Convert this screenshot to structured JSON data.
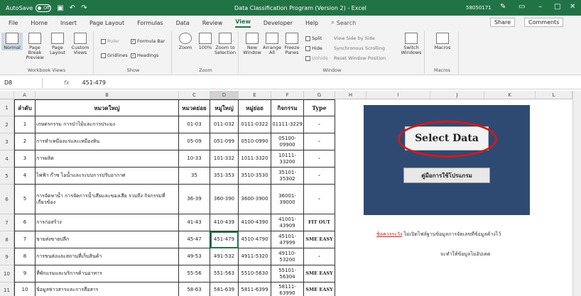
{
  "titlebar": {
    "autosave_label": "AutoSave",
    "autosave_state": "Off",
    "title": "Data Classification Program (Version 2) - Excel",
    "user": "58050171"
  },
  "menu": {
    "tabs": [
      "File",
      "Home",
      "Insert",
      "Page Layout",
      "Formulas",
      "Data",
      "Review",
      "View",
      "Developer",
      "Help"
    ],
    "active_tab": "View",
    "search_label": "Search",
    "share_label": "Share",
    "comments_label": "Comments"
  },
  "ribbon": {
    "workbook_views": {
      "label": "Workbook Views",
      "normal": "Normal",
      "page_break": "Page Break Preview",
      "page_layout": "Page Layout",
      "custom_views": "Custom Views"
    },
    "show": {
      "label": "Show",
      "ruler": "Ruler",
      "gridlines": "Gridlines",
      "formula_bar": "Formula Bar",
      "headings": "Headings"
    },
    "zoom": {
      "label": "Zoom",
      "zoom": "Zoom",
      "pct": "100%",
      "to_selection": "Zoom to Selection"
    },
    "window": {
      "label": "Window",
      "new_window": "New Window",
      "arrange_all": "Arrange All",
      "freeze_panes": "Freeze Panes",
      "split": "Split",
      "hide": "Hide",
      "unhide": "Unhide",
      "side_by_side": "View Side by Side",
      "sync_scroll": "Synchronous Scrolling",
      "reset_pos": "Reset Window Position",
      "switch_windows": "Switch Windows"
    },
    "macros": {
      "label": "Macros",
      "macros": "Macros"
    }
  },
  "formula_bar": {
    "name_box": "D8",
    "fx": "fx",
    "value": "451-479"
  },
  "sheet": {
    "columns": [
      "A",
      "B",
      "C",
      "D",
      "E",
      "F",
      "G",
      "H",
      "I",
      "J",
      "K",
      "L"
    ],
    "selected_column": "D",
    "row_numbers": [
      "1",
      "2",
      "3",
      "4",
      "5",
      "6",
      "7",
      "8",
      "9",
      "10",
      "11"
    ],
    "header": [
      "ลำดับ",
      "หมวดใหญ่",
      "หมวดย่อย",
      "หมู่ใหญ่",
      "หมู่ย่อย",
      "กิจกรรม",
      "Type"
    ],
    "rows": [
      [
        "1",
        "เกษตรกรรม การป่าไม้และการประมง",
        "01-03",
        "011-032",
        "0111-0322",
        "01111-3229",
        "-"
      ],
      [
        "2",
        "การทำเหมืองแร่และเหมืองหิน",
        "05-09",
        "051-099",
        "0510-0990",
        "05100-09900",
        "-"
      ],
      [
        "3",
        "การผลิต",
        "10-33",
        "101-332",
        "1011-3320",
        "10111-33200",
        "-"
      ],
      [
        "4",
        "ไฟฟ้า ก๊าซ ไอน้ำและระบบการปรับอากาศ",
        "35",
        "351-353",
        "3510-3530",
        "35101-35302",
        "-"
      ],
      [
        "5",
        "การจัดหาน้ำ การจัดการน้ำเสียและของเสีย รวมถึง กิจกรรมที่เกี่ยวข้อง",
        "36-39",
        "360-390",
        "3600-3900",
        "36001-39000",
        "-"
      ],
      [
        "6",
        "การก่อสร้าง",
        "41-43",
        "410-439",
        "4100-4390",
        "41001-43909",
        "FIT OUT"
      ],
      [
        "7",
        "ขายส่งขายปลีก",
        "45-47",
        "451-479",
        "4510-4790",
        "45101-47999",
        "SME EASY"
      ],
      [
        "8",
        "การขนส่งและสถานที่เก็บสินค้า",
        "49-53",
        "491-532",
        "4911-5320",
        "49110-53200",
        "-"
      ],
      [
        "9",
        "ที่พักแรมและบริการด้านอาหาร",
        "55-56",
        "551-563",
        "5510-5630",
        "55101-56304",
        "SME EASY"
      ],
      [
        "10",
        "ข้อมูลข่าวสารและการสื่อสาร",
        "58-63",
        "581-639",
        "5811-6399",
        "58111-63990",
        "SME EASY"
      ]
    ]
  },
  "panel": {
    "select_button": "Select Data",
    "manual_button": "คู่มือการใช้โปรแกรม",
    "warning_label": "ข้อควรระวัง",
    "note_line1": " ไม่เปิดไฟล์ฐานข้อมูลการจัดเลขที่ข้อมูลค้างไว้",
    "note_line2": "จะทำให้ข้อมูลไม่อัปเดต"
  },
  "colors": {
    "excel_green": "#217346",
    "panel_blue": "#2f4a72",
    "highlight_red": "#d11a1a"
  }
}
